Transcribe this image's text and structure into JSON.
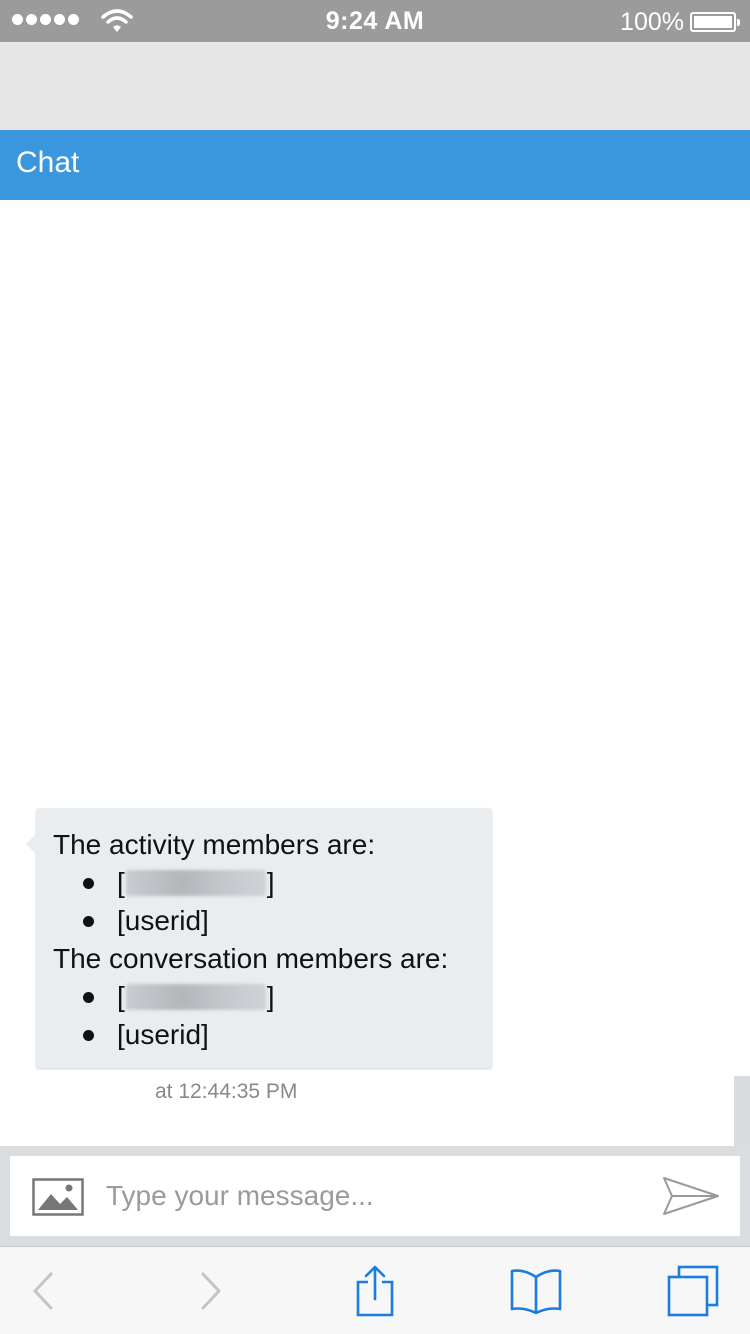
{
  "status_bar": {
    "time": "9:24 AM",
    "battery_percent": "100%",
    "battery_level": 1.0,
    "signal_bars": 5
  },
  "chat": {
    "header_title": "Chat",
    "accent_color": "#3a96dd"
  },
  "message": {
    "activity_heading": "The activity members are:",
    "activity_members": [
      {
        "name": "[",
        "suffix": "]",
        "redacted": true
      },
      {
        "name": "[userid]",
        "redacted": false
      }
    ],
    "conversation_heading": "The conversation members are:",
    "conversation_members": [
      {
        "name": "[",
        "suffix": "]",
        "redacted": true
      },
      {
        "name": "[userid]",
        "redacted": false
      }
    ],
    "timestamp": "at 12:44:35 PM"
  },
  "composer": {
    "placeholder": "Type your message...",
    "value": "",
    "attach_icon": "image-icon",
    "send_icon": "send-icon"
  },
  "toolbar": {
    "icons": [
      "back-icon",
      "forward-icon",
      "share-icon",
      "bookmarks-icon",
      "tabs-icon"
    ]
  }
}
